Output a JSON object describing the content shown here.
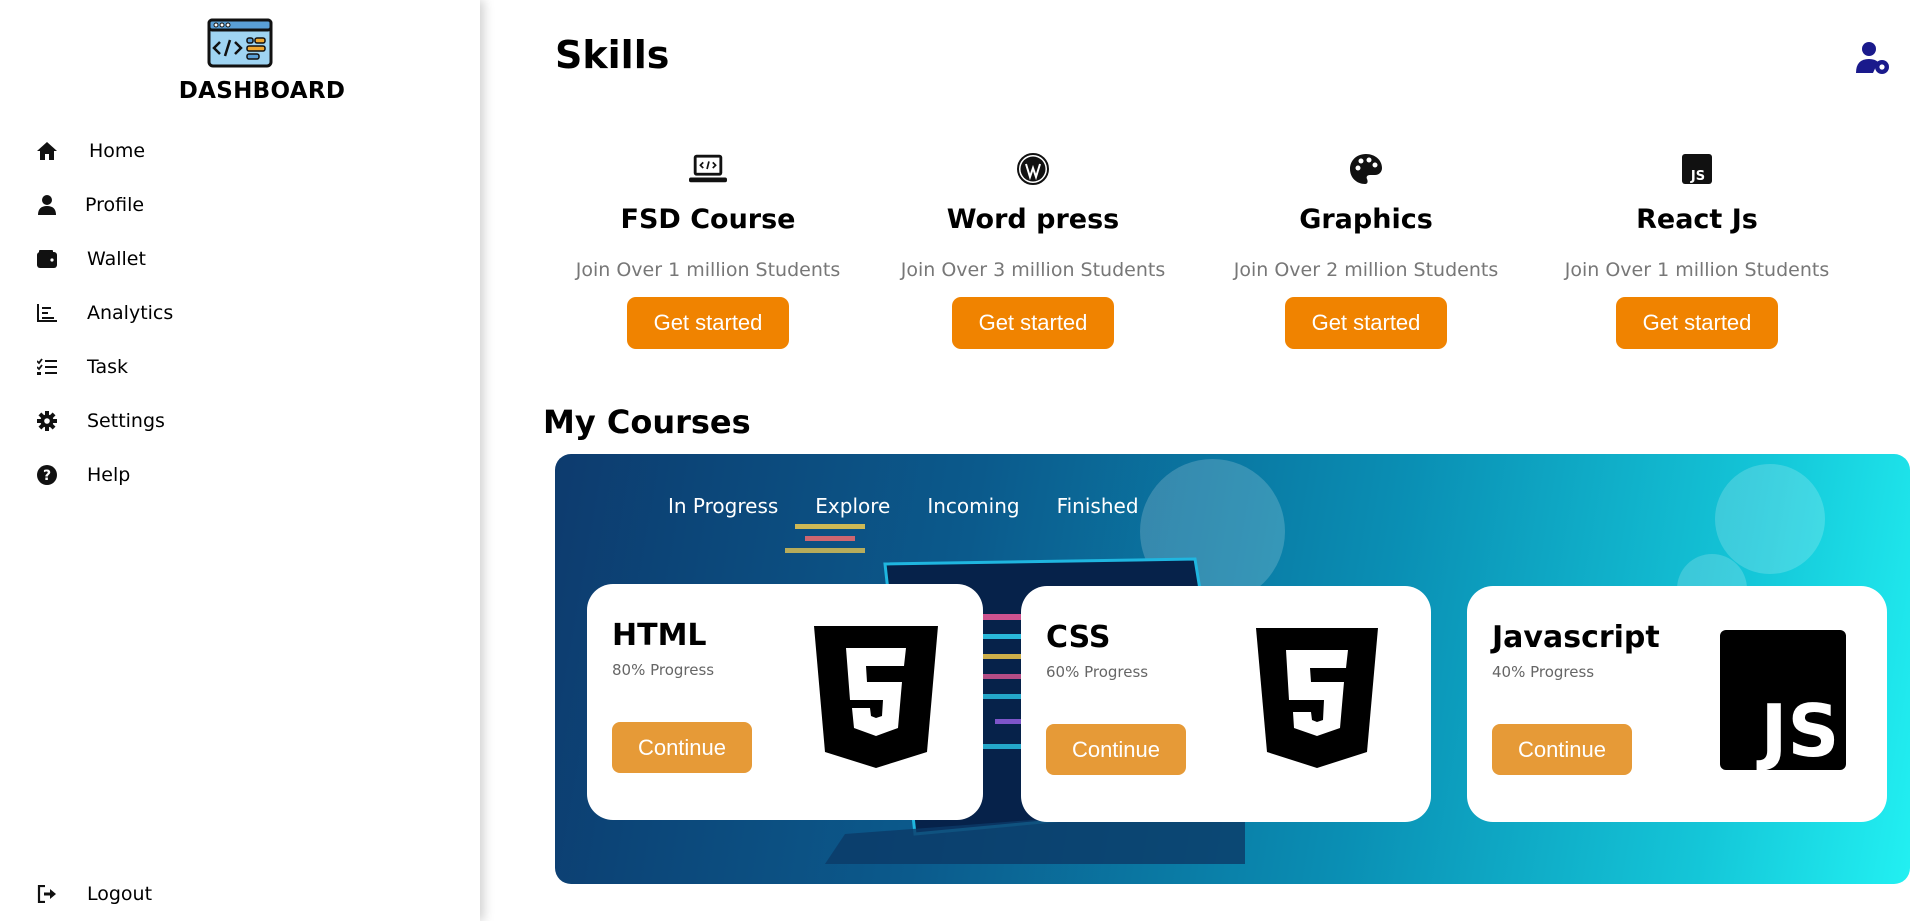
{
  "sidebar": {
    "brand": "DASHBOARD",
    "items": [
      {
        "label": "Home",
        "icon": "home-icon"
      },
      {
        "label": "Profile",
        "icon": "user-icon"
      },
      {
        "label": "Wallet",
        "icon": "wallet-icon"
      },
      {
        "label": "Analytics",
        "icon": "chart-icon"
      },
      {
        "label": "Task",
        "icon": "task-list-icon"
      },
      {
        "label": "Settings",
        "icon": "gear-icon"
      },
      {
        "label": "Help",
        "icon": "question-icon"
      }
    ],
    "logout": "Logout"
  },
  "header": {
    "title": "Skills"
  },
  "skills": [
    {
      "title": "FSD Course",
      "subtitle": "Join Over 1 million Students",
      "button": "Get started",
      "icon": "laptop-code-icon"
    },
    {
      "title": "Word press",
      "subtitle": "Join Over 3 million Students",
      "button": "Get started",
      "icon": "wordpress-icon"
    },
    {
      "title": "Graphics",
      "subtitle": "Join Over 2 million Students",
      "button": "Get started",
      "icon": "palette-icon"
    },
    {
      "title": "React Js",
      "subtitle": "Join Over 1 million Students",
      "button": "Get started",
      "icon": "js-square-icon"
    }
  ],
  "courses": {
    "title": "My Courses",
    "tabs": [
      "In Progress",
      "Explore",
      "Incoming",
      "Finished"
    ],
    "cards": [
      {
        "title": "HTML",
        "progress": "80% Progress",
        "button": "Continue",
        "icon": "html5-icon"
      },
      {
        "title": "CSS",
        "progress": "60% Progress",
        "button": "Continue",
        "icon": "css3-icon"
      },
      {
        "title": "Javascript",
        "progress": "40% Progress",
        "button": "Continue",
        "icon": "js-icon"
      }
    ]
  },
  "colors": {
    "accent": "#f08300",
    "continue": "#e69a37",
    "gear_user": "#1a1a8c"
  }
}
